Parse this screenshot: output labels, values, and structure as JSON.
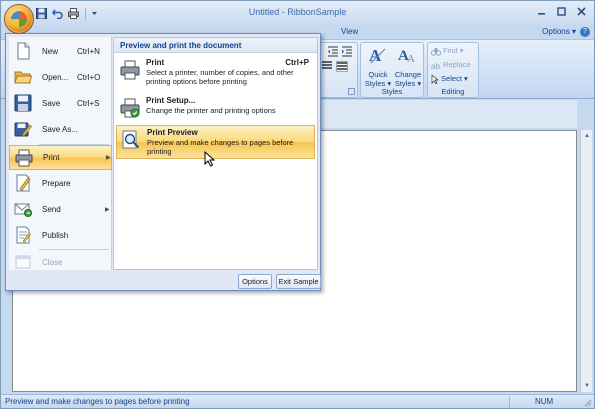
{
  "window": {
    "title_doc": "Untitled",
    "title_sep": " - ",
    "title_app": "RibbonSample"
  },
  "ribbon": {
    "tab_view": "View",
    "options_label": "Options",
    "quick_styles": [
      "Quick",
      "Styles"
    ],
    "change_styles": [
      "Change",
      "Styles"
    ],
    "styles_group": "Styles",
    "find": "Find",
    "replace": "Replace",
    "select": "Select",
    "editing_group": "Editing"
  },
  "app_menu": {
    "left_items": [
      {
        "label": "New",
        "shortcut": "Ctrl+N",
        "icon": "new-document-icon"
      },
      {
        "label": "Open...",
        "shortcut": "Ctrl+O",
        "icon": "open-folder-icon"
      },
      {
        "label": "Save",
        "shortcut": "Ctrl+S",
        "icon": "save-disk-icon"
      },
      {
        "label": "Save As...",
        "shortcut": "",
        "icon": "save-as-icon"
      },
      {
        "label": "Print",
        "shortcut": "",
        "icon": "printer-icon",
        "selected": true,
        "submenu": true
      },
      {
        "label": "Prepare",
        "shortcut": "",
        "icon": "prepare-icon"
      },
      {
        "label": "Send",
        "shortcut": "",
        "icon": "send-icon",
        "submenu": true
      },
      {
        "label": "Publish",
        "shortcut": "",
        "icon": "publish-icon"
      },
      {
        "label": "Close",
        "shortcut": "",
        "icon": "close-document-icon",
        "disabled": true
      }
    ],
    "right_header": "Preview and print the document",
    "right_items": [
      {
        "title": "Print",
        "shortcut": "Ctrl+P",
        "desc": "Select a printer, number of copies, and other printing options before printing"
      },
      {
        "title": "Print Setup...",
        "shortcut": "",
        "desc": "Change the printer and printing options"
      },
      {
        "title": "Print Preview",
        "shortcut": "",
        "desc": "Preview and make changes to pages before printing",
        "selected": true
      }
    ],
    "options_button": "Options",
    "exit_button": "Exit Sample"
  },
  "statusbar": {
    "message": "Preview and make changes to pages before printing",
    "num": "NUM"
  }
}
